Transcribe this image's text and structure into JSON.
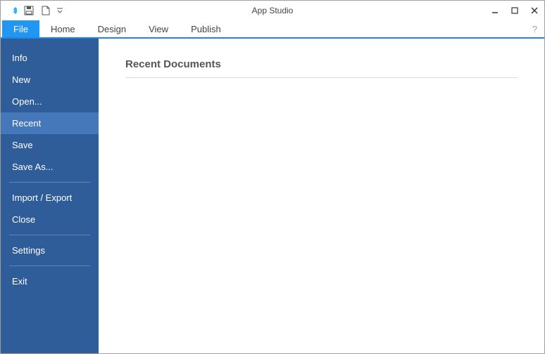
{
  "app_title": "App Studio",
  "ribbon": {
    "file": "File",
    "home": "Home",
    "design": "Design",
    "view": "View",
    "publish": "Publish",
    "help": "?"
  },
  "sidebar": {
    "info": "Info",
    "new": "New",
    "open": "Open...",
    "recent": "Recent",
    "save": "Save",
    "save_as": "Save As...",
    "import_export": "Import / Export",
    "close": "Close",
    "settings": "Settings",
    "exit": "Exit"
  },
  "content": {
    "heading": "Recent Documents"
  },
  "icons": {
    "app": "app-logo",
    "save_qat": "save",
    "new_qat": "new-document",
    "qat_dropdown": "chevron-down"
  }
}
